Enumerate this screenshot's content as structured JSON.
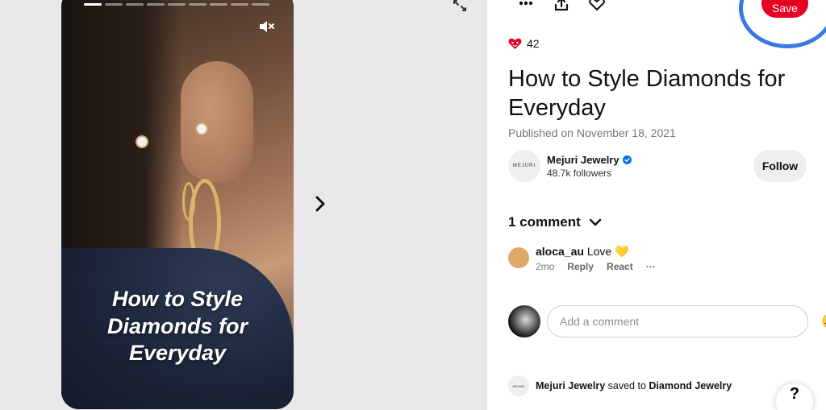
{
  "story": {
    "title_line1": "How to Style",
    "title_line2": "Diamonds for",
    "title_line3": "Everyday",
    "progress_segments": 9,
    "progress_active_index": 0
  },
  "toolbar": {
    "save_label": "Save"
  },
  "pin": {
    "reaction_count": "42",
    "title": "How to Style Diamonds for Everyday",
    "published": "Published on November 18, 2021"
  },
  "creator": {
    "avatar_text": "MEJURI",
    "name": "Mejuri Jewelry",
    "followers": "48.7k followers",
    "follow_label": "Follow"
  },
  "comments": {
    "header": "1 comment",
    "items": [
      {
        "user": "aloca_au",
        "text": "Love 💛",
        "time": "2mo",
        "reply_label": "Reply",
        "react_label": "React",
        "more_label": "···"
      }
    ],
    "input_placeholder": "Add a comment",
    "emoji": "😃"
  },
  "saved": {
    "avatar_text": "MEJURI",
    "user": "Mejuri Jewelry",
    "action": "saved to",
    "board": "Diamond Jewelry"
  },
  "help_label": "?",
  "colors": {
    "save_red": "#e60023",
    "highlight_ring": "#3b78e7",
    "verified_blue": "#0074e8"
  }
}
